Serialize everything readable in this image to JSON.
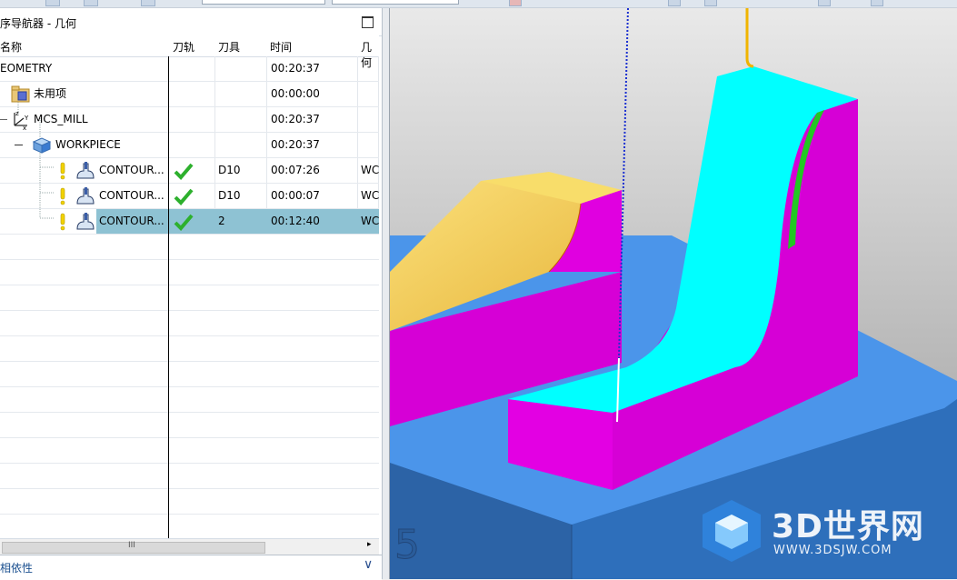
{
  "navigator": {
    "title": "序导航器 - 几何",
    "columns": [
      "名称",
      "刀轨",
      "刀具",
      "时间",
      "几何"
    ],
    "rows": [
      {
        "name": "EOMETRY",
        "tool": "",
        "time": "00:20:37",
        "geom": ""
      },
      {
        "name": "未用项",
        "tool": "",
        "time": "00:00:00",
        "geom": ""
      },
      {
        "name": "MCS_MILL",
        "tool": "",
        "time": "00:20:37",
        "geom": ""
      },
      {
        "name": "WORKPIECE",
        "tool": "",
        "time": "00:20:37",
        "geom": ""
      },
      {
        "name": "CONTOUR...",
        "tool": "D10",
        "time": "00:07:26",
        "geom": "WC"
      },
      {
        "name": "CONTOUR...",
        "tool": "D10",
        "time": "00:00:07",
        "geom": "WC"
      },
      {
        "name": "CONTOUR...",
        "tool": "2",
        "time": "00:12:40",
        "geom": "WC"
      }
    ],
    "scroll_label": "III",
    "dependencies_label": "相依性",
    "colors": {
      "selection": "#8ec2d3",
      "check": "#2db02d",
      "warning": "#f2d200"
    }
  },
  "viewport": {
    "number_label": "5",
    "watermark_title": "3D世界网",
    "watermark_url": "WWW.3DSJW.COM",
    "colors": {
      "top_face": "#00ffff",
      "side_face": "#e000e0",
      "yellow_face": "#f7d648",
      "base": "#3f8fe6",
      "background": "#c8c8c8"
    }
  }
}
